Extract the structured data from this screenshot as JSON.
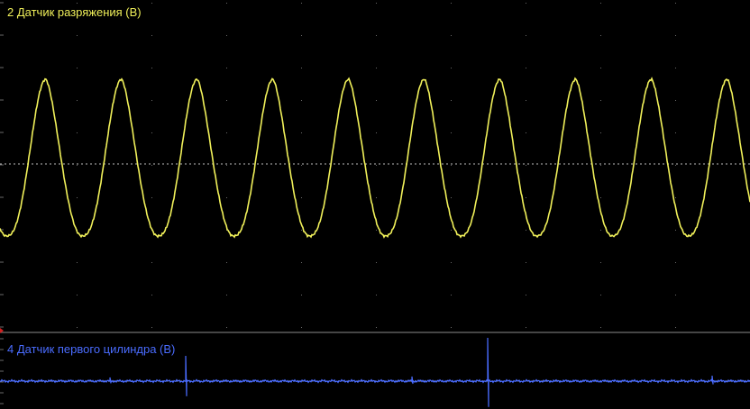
{
  "channels": [
    {
      "name": "2 Датчик разряжения (В)",
      "color": "#f0f05a"
    },
    {
      "name": "4 Датчик первого цилиндра (В)",
      "color": "#4a6cff"
    }
  ],
  "colors": {
    "background": "#000000",
    "grid": "#6a6a6a",
    "divider": "#8c8c8c",
    "marker": "#d02020"
  }
}
